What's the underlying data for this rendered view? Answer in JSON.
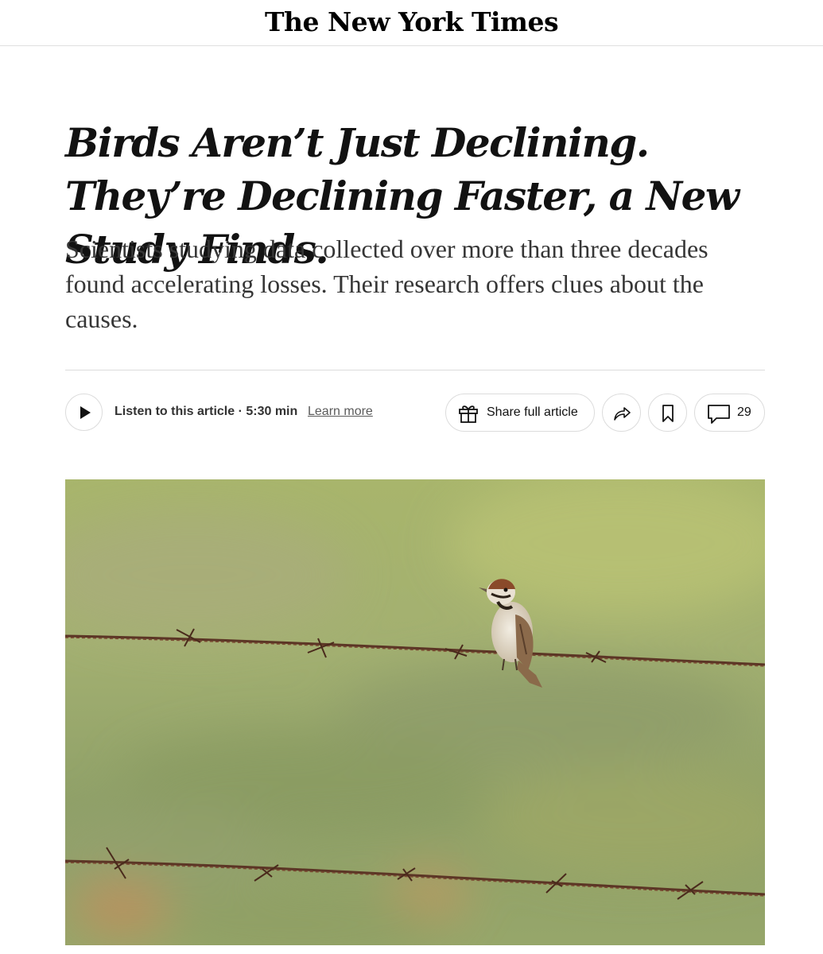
{
  "masthead": {
    "logo_text": "The New York Times"
  },
  "article": {
    "headline": "Birds Aren’t Just Declining. They’re Declining Faster, a New Study Finds.",
    "summary": "Scientists studying data collected over more than three decades found accelerating losses. Their research offers clues about the causes."
  },
  "toolbar": {
    "listen_label": "Listen to this article · 5:30 min",
    "learn_more": "Learn more",
    "share_full_label": "Share full article",
    "comment_count": "29",
    "icons": {
      "play": "play-icon",
      "gift": "gift-icon",
      "share": "share-arrow-icon",
      "save": "bookmark-icon",
      "comments": "comment-bubble-icon"
    }
  },
  "photo": {
    "subject": "bird-on-barbed-wire-photo"
  }
}
